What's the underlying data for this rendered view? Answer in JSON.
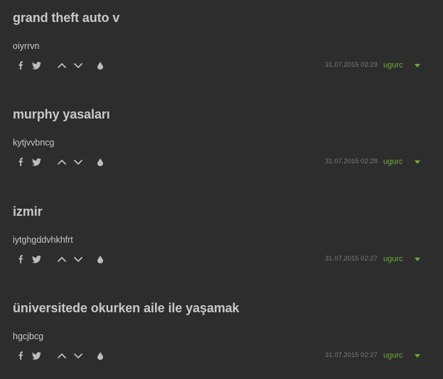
{
  "entries": [
    {
      "title": "grand theft auto v",
      "body": "oiyrrvn",
      "date": "31.07.2015 02:29",
      "author": "ugurc"
    },
    {
      "title": "murphy yasaları",
      "body": "kytjvvbncg",
      "date": "31.07.2015 02:28",
      "author": "ugurc"
    },
    {
      "title": "izmir",
      "body": "iytghgddvhkhfrt",
      "date": "31.07.2015 02:27",
      "author": "ugurc"
    },
    {
      "title": "üniversitede okurken aile ile yaşamak",
      "body": "hgcjbcg",
      "date": "31.07.2015 02:27",
      "author": "ugurc"
    }
  ],
  "icons": {
    "share_facebook": "facebook-icon",
    "share_twitter": "twitter-icon",
    "upvote": "chevron-up-icon",
    "downvote": "chevron-down-icon",
    "favorite": "drop-icon",
    "options": "caret-down-icon"
  },
  "colors": {
    "background": "#2d2d2d",
    "text": "#c8c8c8",
    "muted": "#7a7a7a",
    "author": "#6aae3a",
    "icon": "#bdbdbd"
  }
}
